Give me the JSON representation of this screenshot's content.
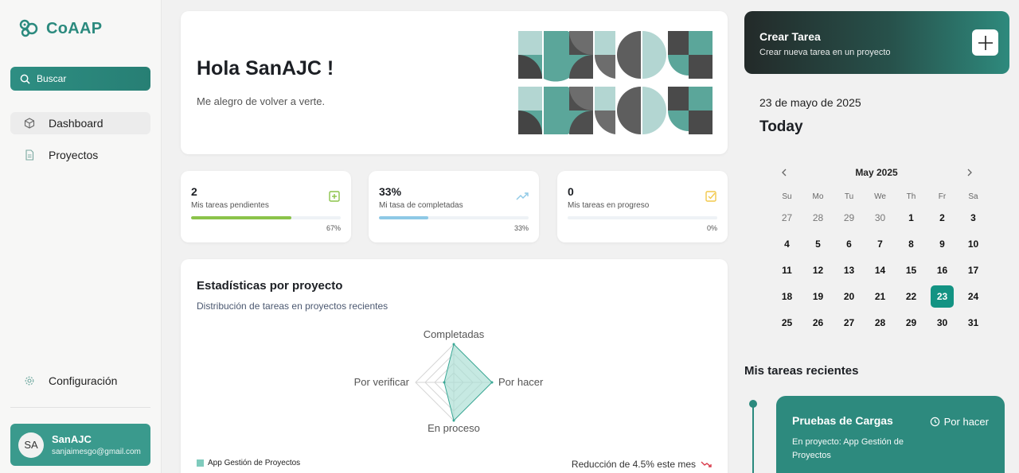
{
  "app": {
    "name": "CoAAP"
  },
  "sidebar": {
    "search_label": "Buscar",
    "items": [
      {
        "label": "Dashboard",
        "icon": "cube-icon",
        "active": true
      },
      {
        "label": "Proyectos",
        "icon": "document-icon",
        "active": false
      }
    ],
    "settings_label": "Configuración",
    "user": {
      "initials": "SA",
      "name": "SanAJC",
      "email": "sanjaimesgo@gmail.com"
    }
  },
  "hero": {
    "title": "Hola SanAJC !",
    "subtitle": "Me alegro de volver a verte."
  },
  "stats": [
    {
      "value": "2",
      "label": "Mis tareas pendientes",
      "percent_label": "67%",
      "progress": 0.67,
      "color": "#8bc34a",
      "icon": "plus-square-icon"
    },
    {
      "value": "33%",
      "label": "Mi tasa de completadas",
      "percent_label": "33%",
      "progress": 0.33,
      "color": "#8ec9e6",
      "icon": "trending-up-icon"
    },
    {
      "value": "0",
      "label": "Mis tareas en progreso",
      "percent_label": "0%",
      "progress": 0,
      "color": "#f2c94c",
      "icon": "check-square-icon"
    }
  ],
  "project_stats": {
    "title": "Estadísticas por proyecto",
    "subtitle": "Distribución de tareas en proyectos recientes",
    "legend": "App Gestión de Proyectos",
    "trend": "Reducción de 4.5% este mes"
  },
  "chart_data": {
    "type": "radar",
    "axes": [
      "Completadas",
      "Por hacer",
      "En proceso",
      "Por verificar"
    ],
    "series": [
      {
        "name": "App Gestión de Proyectos",
        "values": [
          1.0,
          1.0,
          1.0,
          0.25
        ]
      }
    ],
    "range": [
      0,
      1
    ],
    "rings": 4,
    "legend_position": "bottom-left",
    "colors": {
      "fill": "#a7ddd2",
      "stroke": "#3aa896"
    }
  },
  "create_task": {
    "title": "Crear Tarea",
    "subtitle": "Crear nueva tarea en un proyecto"
  },
  "date_label": "23 de mayo de 2025",
  "today_label": "Today",
  "calendar": {
    "month_label": "May 2025",
    "weekdays": [
      "Su",
      "Mo",
      "Tu",
      "We",
      "Th",
      "Fr",
      "Sa"
    ],
    "days": [
      {
        "d": "27",
        "m": true
      },
      {
        "d": "28",
        "m": true
      },
      {
        "d": "29",
        "m": true
      },
      {
        "d": "30",
        "m": true
      },
      {
        "d": "1"
      },
      {
        "d": "2"
      },
      {
        "d": "3"
      },
      {
        "d": "4"
      },
      {
        "d": "5"
      },
      {
        "d": "6"
      },
      {
        "d": "7"
      },
      {
        "d": "8"
      },
      {
        "d": "9"
      },
      {
        "d": "10"
      },
      {
        "d": "11"
      },
      {
        "d": "12"
      },
      {
        "d": "13"
      },
      {
        "d": "14"
      },
      {
        "d": "15"
      },
      {
        "d": "16"
      },
      {
        "d": "17"
      },
      {
        "d": "18"
      },
      {
        "d": "19"
      },
      {
        "d": "20"
      },
      {
        "d": "21"
      },
      {
        "d": "22"
      },
      {
        "d": "23",
        "sel": true
      },
      {
        "d": "24"
      },
      {
        "d": "25"
      },
      {
        "d": "26"
      },
      {
        "d": "27"
      },
      {
        "d": "28"
      },
      {
        "d": "29"
      },
      {
        "d": "30"
      },
      {
        "d": "31"
      }
    ]
  },
  "recent": {
    "title": "Mis tareas recientes",
    "task": {
      "title": "Pruebas de Cargas",
      "status": "Por hacer",
      "project": "En proyecto: App Gestión de Proyectos"
    }
  },
  "colors": {
    "brand": "#2b8a7e",
    "accent": "#139383"
  }
}
